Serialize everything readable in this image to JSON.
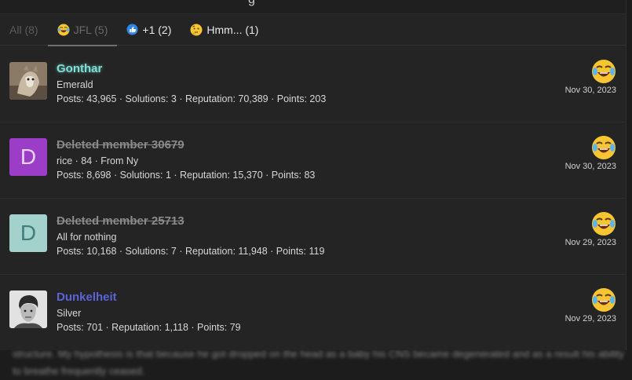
{
  "tabs": [
    {
      "label": "All (8)"
    },
    {
      "label": "JFL (5)"
    },
    {
      "label": "+1 (2)"
    },
    {
      "label": "Hmm... (1)"
    }
  ],
  "rows": [
    {
      "name": "Gonthar",
      "name_color": "#7de0d4",
      "subtitle": "Emerald",
      "stats": "Posts: 43,965 · Solutions: 3 · Reputation: 70,389 · Points: 203",
      "date": "Nov 30, 2023",
      "avatar_letter": ""
    },
    {
      "name": "Deleted member 30679",
      "subtitle": "rice · 84 · From Ny",
      "stats": "Posts: 8,698 · Solutions: 1 · Reputation: 15,370 · Points: 83",
      "date": "Nov 30, 2023",
      "avatar_letter": "D",
      "avatar_bg": "#9b3dc7",
      "avatar_fg": "#e9d6f4"
    },
    {
      "name": "Deleted member 25713",
      "subtitle": "All for nothing",
      "stats": "Posts: 10,168 · Solutions: 7 · Reputation: 11,948 · Points: 119",
      "date": "Nov 29, 2023",
      "avatar_letter": "D",
      "avatar_bg": "#a3d1cc",
      "avatar_fg": "#3f7f78"
    },
    {
      "name": "Dunkelheit",
      "name_color": "#5b63d9",
      "subtitle": "Silver",
      "stats": "Posts: 701 · Reputation: 1,118 · Points: 79",
      "date": "Nov 29, 2023",
      "avatar_letter": ""
    }
  ]
}
